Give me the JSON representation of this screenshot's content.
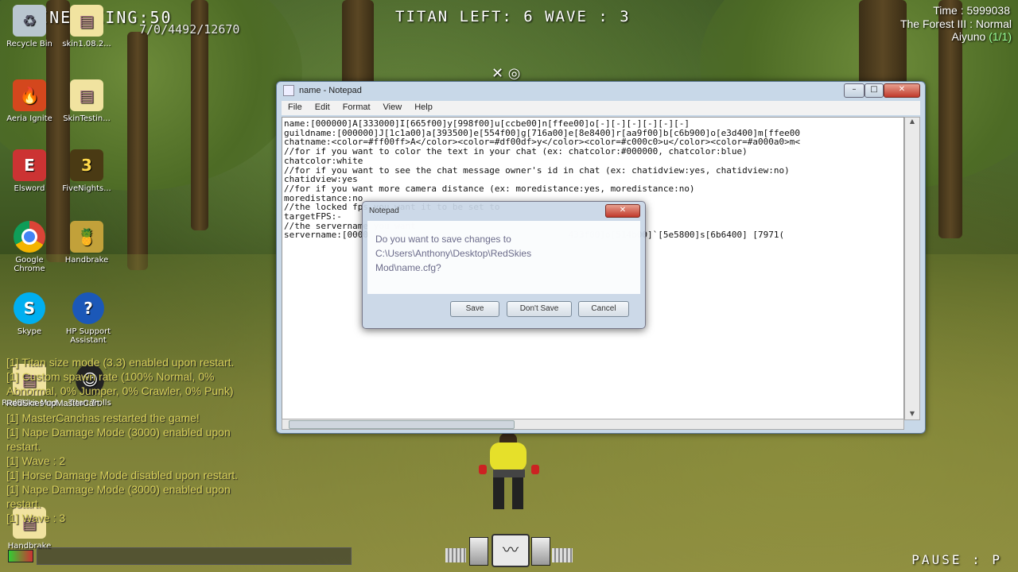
{
  "hud": {
    "joined": "JOINED KING:50",
    "stats": "7/0/4492/12670",
    "titan_wave": "TITAN LEFT: 6 WAVE : 3",
    "time": "Time : 5999038",
    "map": "The Forest III : Normal",
    "player": "Aiyuno",
    "player_count": "(1/1)",
    "pause": "PAUSE : P"
  },
  "desktop_icons": [
    {
      "label": "Recycle Bin",
      "icon": "recycle-bin-icon"
    },
    {
      "label": "skin1.08.2...",
      "icon": "folder-icon"
    },
    {
      "label": "Aeria Ignite",
      "icon": "aeria-ignite-icon"
    },
    {
      "label": "SkinTestin...",
      "icon": "folder-icon"
    },
    {
      "label": "Elsword",
      "icon": "elsword-icon"
    },
    {
      "label": "FiveNights...",
      "icon": "fivenights-icon"
    },
    {
      "label": "Google Chrome",
      "icon": "chrome-icon"
    },
    {
      "label": "Handbrake",
      "icon": "handbrake-icon"
    },
    {
      "label": "Skype",
      "icon": "skype-icon"
    },
    {
      "label": "HP Support Assistant",
      "icon": "hp-support-icon"
    },
    {
      "label": "RedSkies Mod",
      "icon": "folder-icon"
    },
    {
      "label": "Titan Trolls",
      "icon": "avatar-icon"
    },
    {
      "label": "Handbrake",
      "icon": "handbrake-icon"
    }
  ],
  "chat": [
    "[1] Titan size mode (3.3) enabled upon restart.",
    "[1] Custom spawn rate (100% Normal, 0%",
    "Abnormal, 0% Jumper, 0% Crawler, 0% Punk)",
    "RedSkies upMasterCart.",
    "[1] MasterCanchas restarted the game!",
    "[1] Nape Damage Mode (3000) enabled upon",
    "restart.",
    "[1] Wave : 2",
    "[1] Horse Damage Mode disabled upon restart.",
    "[1] Nape Damage Mode (3000) enabled upon",
    "restart.",
    "[1] Wave : 3"
  ],
  "notepad": {
    "title": "name - Notepad",
    "minimize": "–",
    "maximize": "□",
    "close": "✕",
    "menu": [
      "File",
      "Edit",
      "Format",
      "View",
      "Help"
    ],
    "lines": [
      "name:[000000]A[333000]I[665f00]y[998f00]u[ccbe00]n[ffee00]o[-][-][-][-][-][-]",
      "guildname:[000000]J[1c1a00]a[393500]e[554f00]g[716a00]e[8e8400]r[aa9f00]b[c6b900]o[e3d400]m[ffee00",
      "chatname:<color=#ff00ff>A</color><color=#df00df>y</color><color=#c000c0>u</color><color=#a000a0>m<",
      "//for if you want to color the text in your chat (ex: chatcolor:#000000, chatcolor:blue)",
      "chatcolor:white",
      "//for if you want to see the chat message owner's id in chat (ex: chatidview:yes, chatidview:no)",
      "chatidview:yes",
      "//for if you want more camera distance (ex: moredistance:yes, moredistance:no)",
      "moredistance:no",
      "//the locked fps you want it to be set to",
      "targetFPS:-",
      "//the servername you want",
      "servername:[0000                                      433f00]o[514b00]`[5e5800]s[6b6400] [7971("
    ]
  },
  "dialog": {
    "title": "Notepad",
    "close": "✕",
    "message": "Do you want to save changes to C:\\Users\\Anthony\\Desktop\\RedSkies Mod\\name.cfg?",
    "save": "Save",
    "dont_save": "Don't Save",
    "cancel": "Cancel"
  },
  "colors": {
    "chat": "#d9d05a",
    "hud": "#ffffff",
    "window_frame": "#c8d8e8"
  }
}
